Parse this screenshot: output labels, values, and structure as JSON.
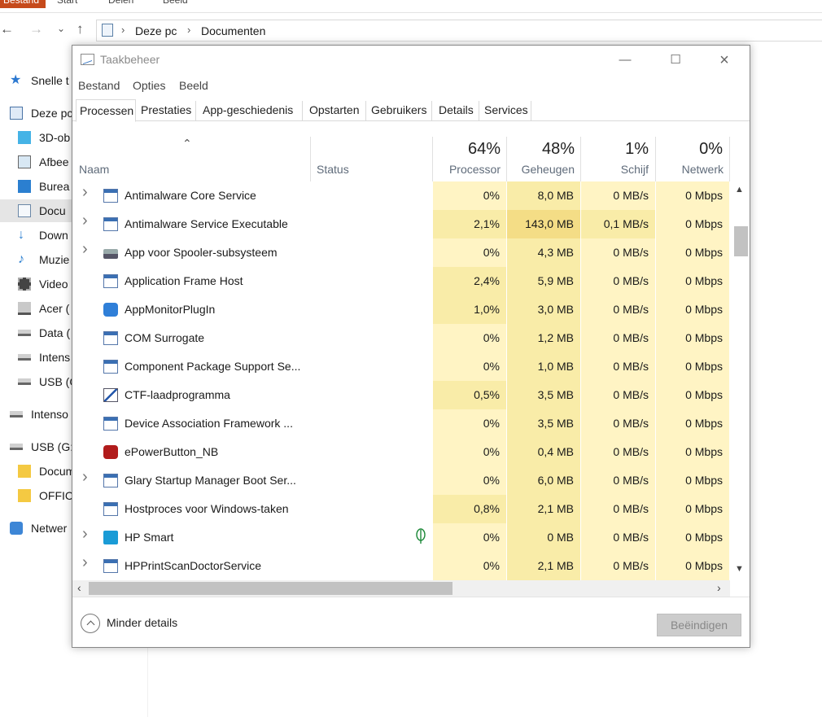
{
  "explorer": {
    "ribbon_tabs": [
      "Bestand",
      "Start",
      "Delen",
      "Beeld"
    ],
    "breadcrumb": [
      "Deze pc",
      "Documenten"
    ],
    "nav_items": [
      {
        "label": "Snelle t",
        "icon": "star-icon"
      },
      {
        "label": "Deze pc",
        "icon": "pc-icon"
      },
      {
        "label": "3D-ob",
        "icon": "cube-icon"
      },
      {
        "label": "Afbee",
        "icon": "picture-icon"
      },
      {
        "label": "Burea",
        "icon": "desktop-icon"
      },
      {
        "label": "Docu",
        "icon": "document-icon"
      },
      {
        "label": "Down",
        "icon": "download-icon"
      },
      {
        "label": "Muzie",
        "icon": "music-icon"
      },
      {
        "label": "Video",
        "icon": "video-icon"
      },
      {
        "label": "Acer (",
        "icon": "windows-drive-icon"
      },
      {
        "label": "Data (",
        "icon": "drive-icon"
      },
      {
        "label": "Intens",
        "icon": "drive-icon"
      },
      {
        "label": "USB (C",
        "icon": "drive-icon"
      },
      {
        "label": "Intenso",
        "icon": "drive-icon"
      },
      {
        "label": "USB (G:",
        "icon": "drive-icon"
      },
      {
        "label": "Docum",
        "icon": "folder-icon"
      },
      {
        "label": "OFFICI",
        "icon": "folder-icon"
      },
      {
        "label": "Netwer",
        "icon": "network-icon"
      }
    ]
  },
  "taskmgr": {
    "title": "Taakbeheer",
    "menu": [
      "Bestand",
      "Opties",
      "Beeld"
    ],
    "tabs": [
      "Processen",
      "Prestaties",
      "App-geschiedenis",
      "Opstarten",
      "Gebruikers",
      "Details",
      "Services"
    ],
    "active_tab": "Processen",
    "columns": {
      "name": "Naam",
      "status": "Status",
      "cpu": {
        "pct": "64%",
        "label": "Processor"
      },
      "mem": {
        "pct": "48%",
        "label": "Geheugen"
      },
      "disk": {
        "pct": "1%",
        "label": "Schijf"
      },
      "net": {
        "pct": "0%",
        "label": "Netwerk"
      }
    },
    "processes": [
      {
        "name": "Antimalware Core Service",
        "expandable": true,
        "icon": "service-window-icon",
        "cpu": "0%",
        "mem": "8,0 MB",
        "disk": "0 MB/s",
        "net": "0 Mbps",
        "status_icon": null,
        "heat": [
          0,
          1,
          0,
          0
        ]
      },
      {
        "name": "Antimalware Service Executable",
        "expandable": true,
        "icon": "service-window-icon",
        "cpu": "2,1%",
        "mem": "143,0 MB",
        "disk": "0,1 MB/s",
        "net": "0 Mbps",
        "status_icon": null,
        "heat": [
          1,
          2,
          1,
          0
        ]
      },
      {
        "name": "App voor Spooler-subsysteem",
        "expandable": true,
        "icon": "printer-icon",
        "cpu": "0%",
        "mem": "4,3 MB",
        "disk": "0 MB/s",
        "net": "0 Mbps",
        "status_icon": null,
        "heat": [
          0,
          1,
          0,
          0
        ]
      },
      {
        "name": "Application Frame Host",
        "expandable": false,
        "icon": "service-window-icon",
        "cpu": "2,4%",
        "mem": "5,9 MB",
        "disk": "0 MB/s",
        "net": "0 Mbps",
        "status_icon": null,
        "heat": [
          1,
          1,
          0,
          0
        ]
      },
      {
        "name": "AppMonitorPlugIn",
        "expandable": false,
        "icon": "app-monitor-icon",
        "cpu": "1,0%",
        "mem": "3,0 MB",
        "disk": "0 MB/s",
        "net": "0 Mbps",
        "status_icon": null,
        "heat": [
          1,
          1,
          0,
          0
        ]
      },
      {
        "name": "COM Surrogate",
        "expandable": false,
        "icon": "service-window-icon",
        "cpu": "0%",
        "mem": "1,2 MB",
        "disk": "0 MB/s",
        "net": "0 Mbps",
        "status_icon": null,
        "heat": [
          0,
          1,
          0,
          0
        ]
      },
      {
        "name": "Component Package Support Se...",
        "expandable": false,
        "icon": "service-window-icon",
        "cpu": "0%",
        "mem": "1,0 MB",
        "disk": "0 MB/s",
        "net": "0 Mbps",
        "status_icon": null,
        "heat": [
          0,
          1,
          0,
          0
        ]
      },
      {
        "name": "CTF-laadprogramma",
        "expandable": false,
        "icon": "pen-icon",
        "cpu": "0,5%",
        "mem": "3,5 MB",
        "disk": "0 MB/s",
        "net": "0 Mbps",
        "status_icon": null,
        "heat": [
          1,
          1,
          0,
          0
        ]
      },
      {
        "name": "Device Association Framework ...",
        "expandable": false,
        "icon": "service-window-icon",
        "cpu": "0%",
        "mem": "3,5 MB",
        "disk": "0 MB/s",
        "net": "0 Mbps",
        "status_icon": null,
        "heat": [
          0,
          1,
          0,
          0
        ]
      },
      {
        "name": "ePowerButton_NB",
        "expandable": false,
        "icon": "power-icon",
        "cpu": "0%",
        "mem": "0,4 MB",
        "disk": "0 MB/s",
        "net": "0 Mbps",
        "status_icon": null,
        "heat": [
          0,
          1,
          0,
          0
        ]
      },
      {
        "name": "Glary Startup Manager Boot Ser...",
        "expandable": true,
        "icon": "service-window-icon",
        "cpu": "0%",
        "mem": "6,0 MB",
        "disk": "0 MB/s",
        "net": "0 Mbps",
        "status_icon": null,
        "heat": [
          0,
          1,
          0,
          0
        ]
      },
      {
        "name": "Hostproces voor Windows-taken",
        "expandable": false,
        "icon": "service-window-icon",
        "cpu": "0,8%",
        "mem": "2,1 MB",
        "disk": "0 MB/s",
        "net": "0 Mbps",
        "status_icon": null,
        "heat": [
          1,
          1,
          0,
          0
        ]
      },
      {
        "name": "HP Smart",
        "expandable": true,
        "icon": "hp-smart-icon",
        "cpu": "0%",
        "mem": "0 MB",
        "disk": "0 MB/s",
        "net": "0 Mbps",
        "status_icon": "leaf-icon",
        "heat": [
          0,
          1,
          0,
          0
        ]
      },
      {
        "name": "HPPrintScanDoctorService",
        "expandable": true,
        "icon": "service-window-icon",
        "cpu": "0%",
        "mem": "2,1 MB",
        "disk": "0 MB/s",
        "net": "0 Mbps",
        "status_icon": null,
        "heat": [
          0,
          1,
          0,
          0
        ]
      }
    ],
    "footer": {
      "less_details": "Minder details",
      "end_task": "Beëindigen"
    },
    "colors": {
      "heat_low": "#fff4c4",
      "heat_mid": "#f9eca8",
      "heat_high": "#f4dd86",
      "accent": "#1979ca"
    }
  }
}
